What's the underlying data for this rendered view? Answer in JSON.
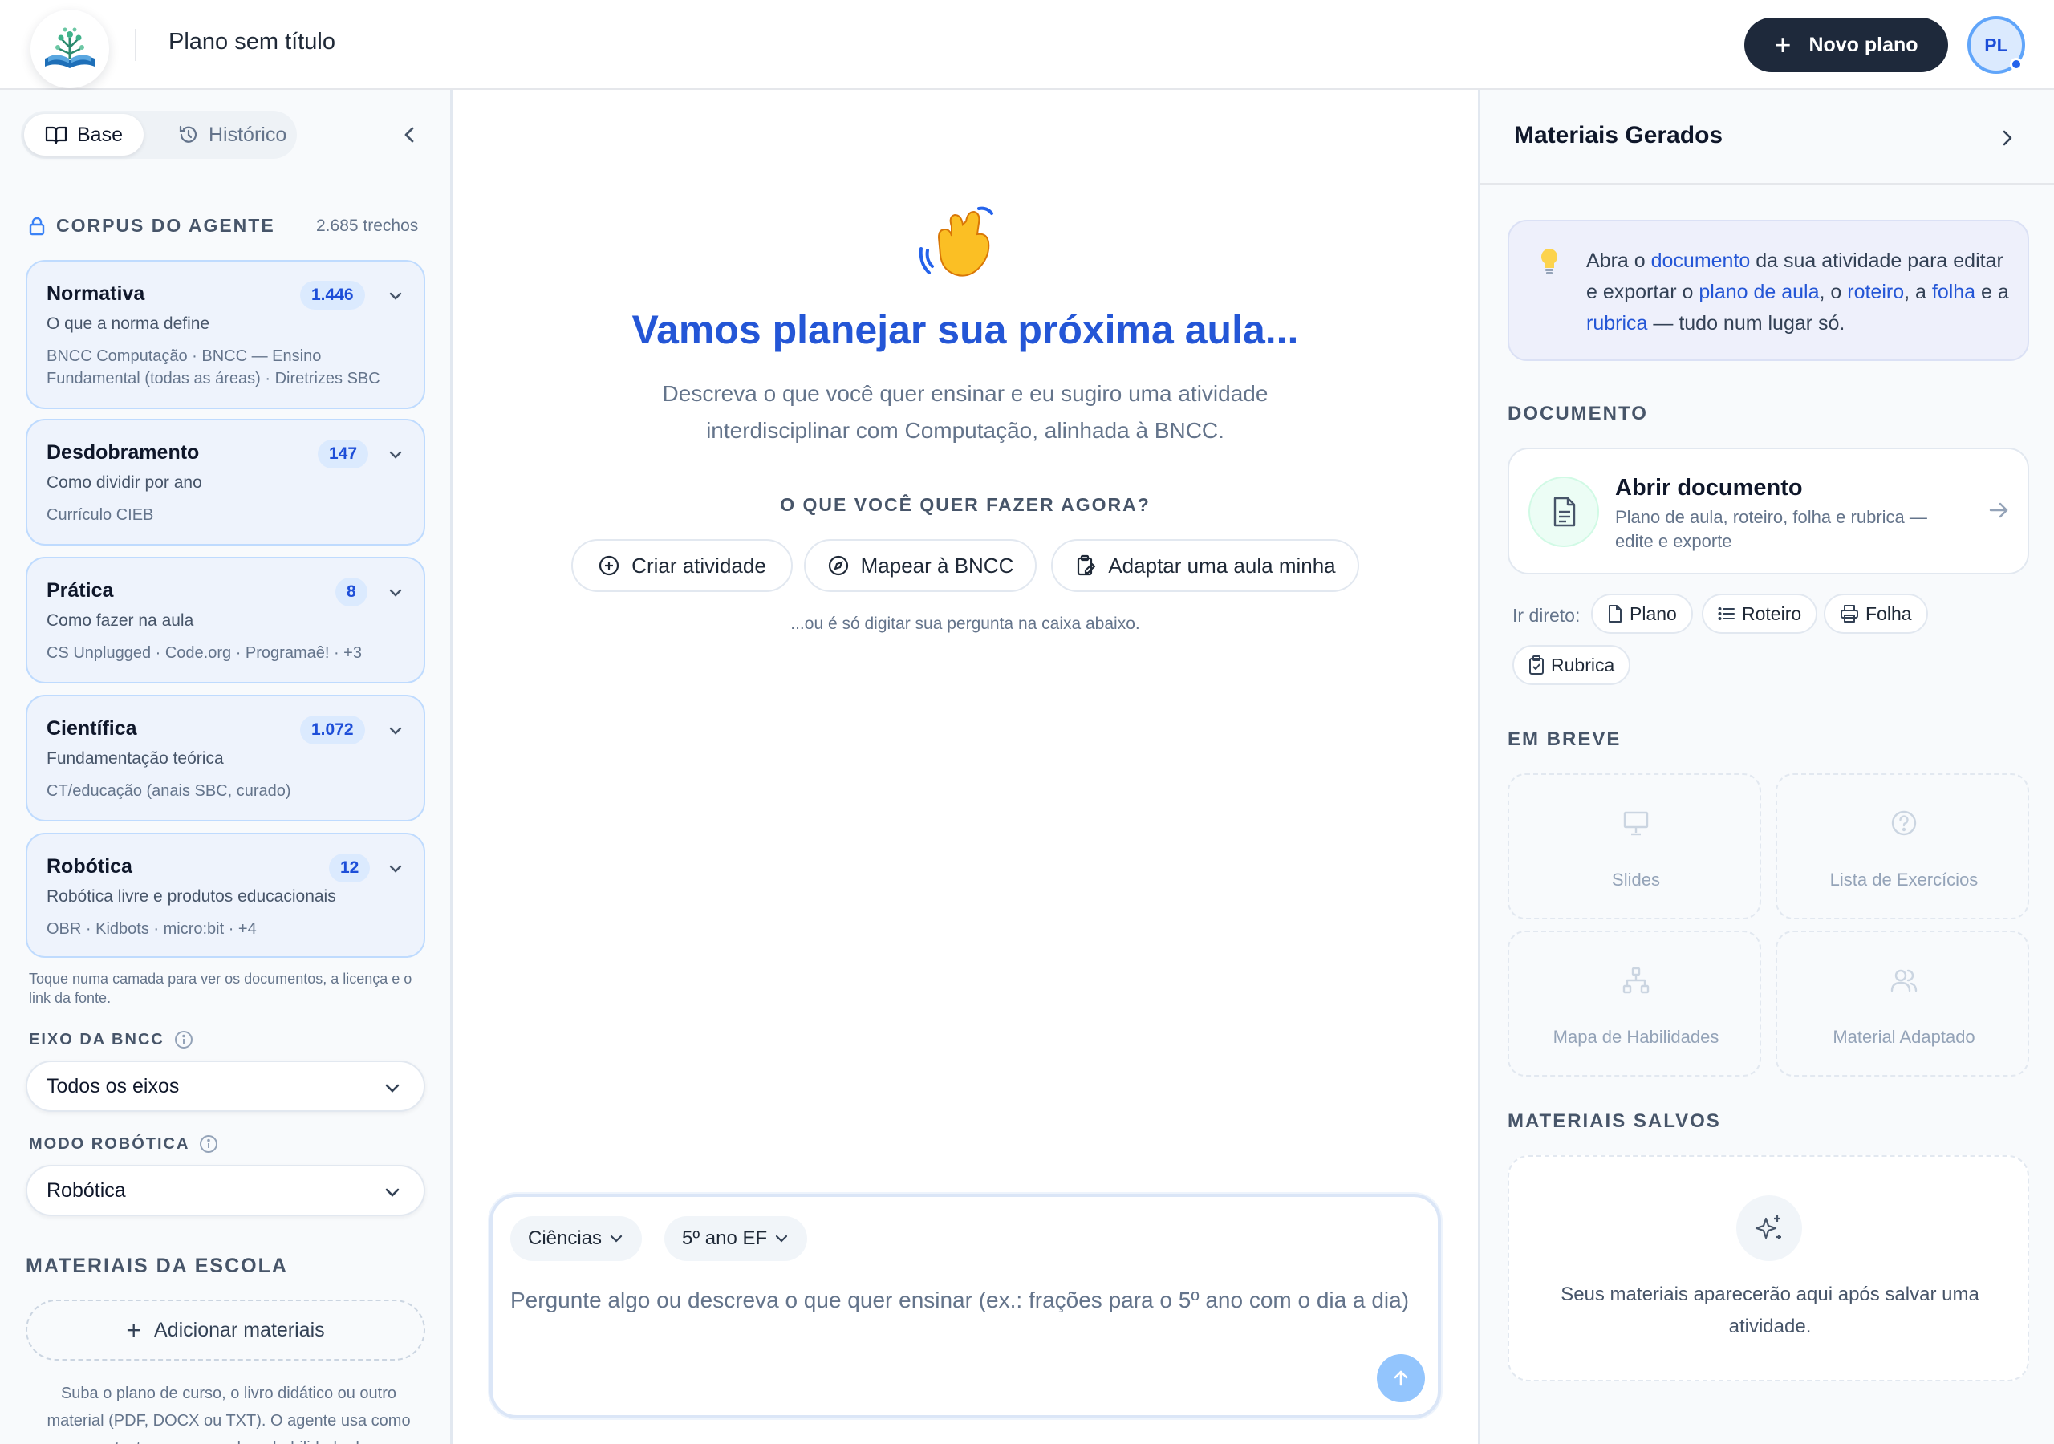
{
  "header": {
    "doc_title": "Plano sem título",
    "new_plan_label": "Novo plano",
    "avatar_initials": "PL"
  },
  "left": {
    "tabs": [
      {
        "label": "Base",
        "icon": "book-icon",
        "active": true
      },
      {
        "label": "Histórico",
        "icon": "history-icon",
        "active": false
      }
    ],
    "corpus": {
      "title": "CORPUS DO AGENTE",
      "count": "2.685 trechos",
      "layers": [
        {
          "title": "Normativa",
          "badge": "1.446",
          "subtitle": "O que a norma define",
          "sources": "BNCC Computação · BNCC — Ensino Fundamental (todas as áreas) · Diretrizes SBC"
        },
        {
          "title": "Desdobramento",
          "badge": "147",
          "subtitle": "Como dividir por ano",
          "sources": "Currículo CIEB"
        },
        {
          "title": "Prática",
          "badge": "8",
          "subtitle": "Como fazer na aula",
          "sources": "CS Unplugged · Code.org · Programaê! · +3"
        },
        {
          "title": "Científica",
          "badge": "1.072",
          "subtitle": "Fundamentação teórica",
          "sources": "CT/educação (anais SBC, curado)"
        },
        {
          "title": "Robótica",
          "badge": "12",
          "subtitle": "Robótica livre e produtos educacionais",
          "sources": "OBR · Kidbots · micro:bit · +4"
        }
      ],
      "hint": "Toque numa camada para ver os documentos, a licença e o link da fonte."
    },
    "bncc_axis": {
      "label": "EIXO DA BNCC",
      "value": "Todos os eixos"
    },
    "robotics_mode": {
      "label": "MODO ROBÓTICA",
      "value": "Robótica"
    },
    "school_materials": {
      "title": "MATERIAIS DA ESCOLA",
      "add_label": "Adicionar materiais",
      "note": "Suba o plano de curso, o livro didático ou outro material (PDF, DOCX ou TXT). O agente usa como contexto — sem mudar a habilidade da"
    }
  },
  "center": {
    "headline": "Vamos planejar sua próxima aula...",
    "lead": "Descreva o que você quer ensinar e eu sugiro uma atividade interdisciplinar com Computação, alinhada à BNCC.",
    "prompt_question": "O QUE VOCÊ QUER FAZER AGORA?",
    "quick_actions": [
      {
        "label": "Criar atividade",
        "icon": "plus-circle-icon"
      },
      {
        "label": "Mapear à BNCC",
        "icon": "compass-icon"
      },
      {
        "label": "Adaptar uma aula minha",
        "icon": "clipboard-edit-icon"
      }
    ],
    "alt_hint": "...ou é só digitar sua pergunta na caixa abaixo.",
    "composer": {
      "subject": "Ciências",
      "grade": "5º ano EF",
      "placeholder": "Pergunte algo ou descreva o que quer ensinar (ex.: frações para o 5º ano com o dia a dia)"
    }
  },
  "right": {
    "title": "Materiais Gerados",
    "tip": {
      "p1": "Abra o ",
      "l1": "documento",
      "p2": " da sua atividade para editar e exportar o ",
      "l2": "plano de aula",
      "p3": ", o ",
      "l3": "roteiro",
      "p4": ", a ",
      "l4": "folha",
      "p5": " e a ",
      "l5": "rubrica",
      "p6": " — tudo num lugar só."
    },
    "document_section": "DOCUMENTO",
    "document": {
      "title": "Abrir documento",
      "subtitle": "Plano de aula, roteiro, folha e rubrica — edite e exporte"
    },
    "go_direct_label": "Ir direto:",
    "go_direct": [
      {
        "label": "Plano",
        "icon": "file-icon"
      },
      {
        "label": "Roteiro",
        "icon": "list-icon"
      },
      {
        "label": "Folha",
        "icon": "printer-icon"
      },
      {
        "label": "Rubrica",
        "icon": "clipboard-check-icon"
      }
    ],
    "soon_section": "EM BREVE",
    "soon_items": [
      {
        "label": "Slides",
        "icon": "presentation-icon"
      },
      {
        "label": "Lista de Exercícios",
        "icon": "help-circle-icon"
      },
      {
        "label": "Mapa de Habilidades",
        "icon": "network-icon"
      },
      {
        "label": "Material Adaptado",
        "icon": "users-icon"
      }
    ],
    "saved_section": "MATERIAIS SALVOS",
    "saved_empty": "Seus materiais aparecerão aqui após salvar uma atividade."
  },
  "colors": {
    "accent": "#2456d6",
    "dark_button": "#1e293b",
    "card_bg": "#eef3fc",
    "badge_bg": "#dbeafe"
  }
}
